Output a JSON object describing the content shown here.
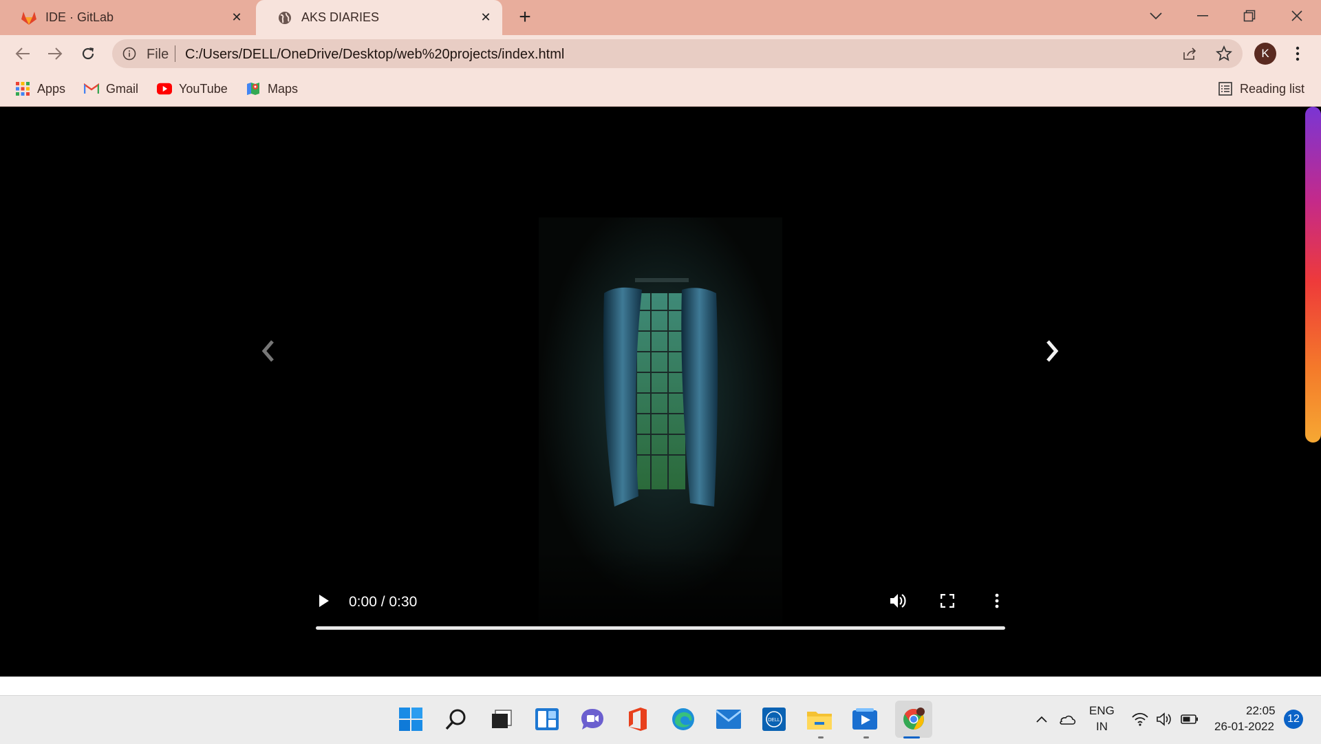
{
  "browser": {
    "tabs": [
      {
        "title": "IDE · GitLab",
        "icon": "gitlab-icon",
        "active": false
      },
      {
        "title": "AKS DIARIES",
        "icon": "globe-icon",
        "active": true
      }
    ],
    "address": {
      "scheme_label": "File",
      "url": "C:/Users/DELL/OneDrive/Desktop/web%20projects/index.html"
    },
    "profile_initial": "K",
    "bookmarks": [
      {
        "label": "Apps",
        "icon": "apps-grid-icon"
      },
      {
        "label": "Gmail",
        "icon": "gmail-icon"
      },
      {
        "label": "YouTube",
        "icon": "youtube-icon"
      },
      {
        "label": "Maps",
        "icon": "maps-icon"
      }
    ],
    "reading_list_label": "Reading list"
  },
  "video": {
    "time_display": "0:00 / 0:30",
    "progress": 0
  },
  "taskbar": {
    "apps": [
      "windows-start-icon",
      "search-icon",
      "task-view-icon",
      "widgets-icon",
      "teams-chat-icon",
      "office-icon",
      "edge-icon",
      "mail-icon",
      "dell-icon",
      "file-explorer-icon",
      "media-player-icon",
      "chrome-icon"
    ],
    "language": {
      "line1": "ENG",
      "line2": "IN"
    },
    "time": "22:05",
    "date": "26-01-2022",
    "notification_count": "12"
  },
  "colors": {
    "tab_strip": "#e8ad9c",
    "toolbar": "#f7e3dc",
    "omnibox": "#e8cdc4",
    "page_background": "#000000",
    "taskbar": "#ececec",
    "notification_badge": "#0b63c7"
  }
}
